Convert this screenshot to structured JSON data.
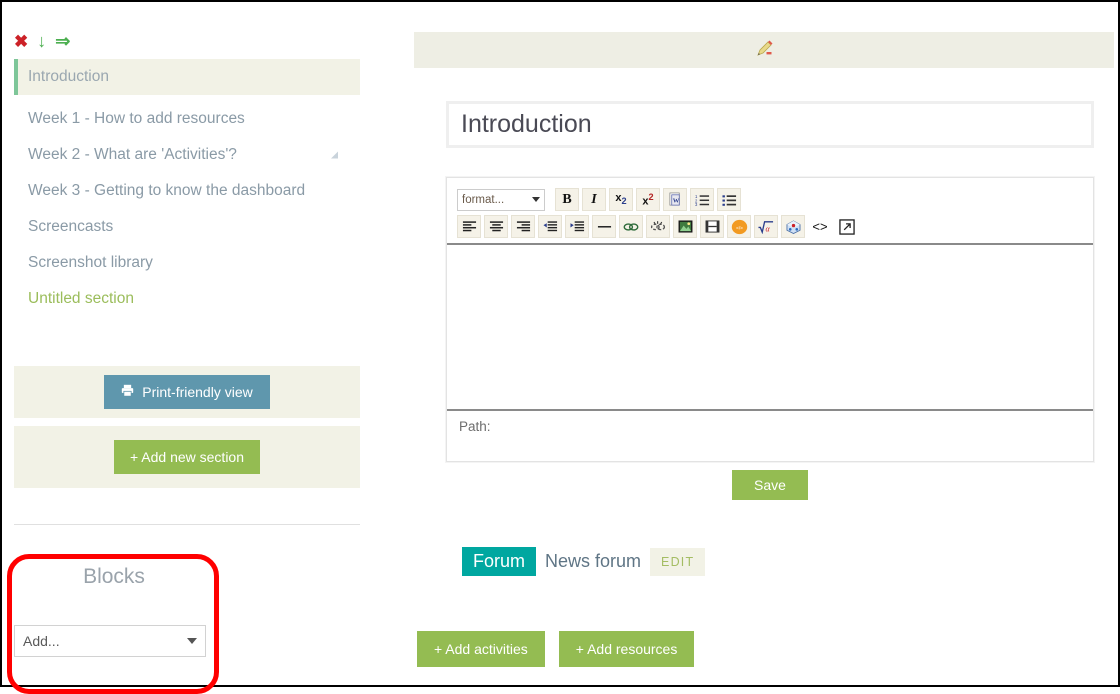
{
  "sidebar": {
    "section_tools": [
      {
        "name": "delete-section",
        "glyph": "✖",
        "label": "Delete section"
      },
      {
        "name": "move-down",
        "glyph": "↓",
        "label": "Move down"
      },
      {
        "name": "move-right",
        "glyph": "⇒",
        "label": "Move right"
      }
    ],
    "sections": [
      {
        "label": "Introduction",
        "active": true,
        "handle": false,
        "untitled": false
      },
      {
        "label": "Week 1 - How to add resources",
        "active": false,
        "handle": false,
        "untitled": false
      },
      {
        "label": "Week 2 - What are 'Activities'?",
        "active": false,
        "handle": true,
        "untitled": false
      },
      {
        "label": "Week 3 - Getting to know the dashboard",
        "active": false,
        "handle": false,
        "untitled": false
      },
      {
        "label": "Screencasts",
        "active": false,
        "handle": false,
        "untitled": false
      },
      {
        "label": "Screenshot library",
        "active": false,
        "handle": false,
        "untitled": false
      },
      {
        "label": "Untitled section",
        "active": false,
        "handle": false,
        "untitled": true
      }
    ],
    "print_button": "Print-friendly view",
    "add_section_button": "+ Add new section",
    "blocks": {
      "title": "Blocks",
      "add_select_value": "Add..."
    }
  },
  "main": {
    "edit_bar_icon": "pencil-icon",
    "title_value": "Introduction",
    "editor": {
      "format_select_value": "format...",
      "toolbar_row1": [
        {
          "name": "bold-icon",
          "label": "B"
        },
        {
          "name": "italic-icon",
          "label": "I"
        },
        {
          "name": "subscript-icon",
          "label": "x₂"
        },
        {
          "name": "superscript-icon",
          "label": "x²"
        },
        {
          "name": "paste-from-word-icon",
          "label": "W"
        },
        {
          "name": "ordered-list-icon",
          "label": "1."
        },
        {
          "name": "unordered-list-icon",
          "label": "•"
        }
      ],
      "toolbar_row2": [
        {
          "name": "align-left-icon",
          "label": "≡"
        },
        {
          "name": "align-center-icon",
          "label": "≡"
        },
        {
          "name": "align-right-icon",
          "label": "≡"
        },
        {
          "name": "outdent-icon",
          "label": "⇤"
        },
        {
          "name": "indent-icon",
          "label": "⇥"
        },
        {
          "name": "horizontal-rule-icon",
          "label": "—"
        },
        {
          "name": "insert-link-icon",
          "label": "⚭"
        },
        {
          "name": "unlink-icon",
          "label": "⚭"
        },
        {
          "name": "insert-image-icon",
          "label": "▣"
        },
        {
          "name": "insert-media-icon",
          "label": "▥"
        },
        {
          "name": "embed-code-icon",
          "label": "</>"
        },
        {
          "name": "equation-editor-icon",
          "label": "√α"
        },
        {
          "name": "chemistry-editor-icon",
          "label": "⬟"
        },
        {
          "name": "html-source-icon",
          "label": "<>"
        },
        {
          "name": "fullscreen-icon",
          "label": "⤡"
        }
      ],
      "content": "",
      "path_label": "Path:"
    },
    "save_button": "Save",
    "forum": {
      "badge": "Forum",
      "link": "News forum",
      "edit_button": "EDIT"
    },
    "add_activities_button": "+ Add activities",
    "add_resources_button": "+ Add resources"
  },
  "annotation": {
    "highlight_color": "#ff0000",
    "target": "blocks-panel"
  },
  "colors": {
    "accent_green": "#94bc52",
    "teal": "#00a7a0",
    "blue_gray": "#5f97ad",
    "cream": "#f2f2e6",
    "muted_text": "#8a9aa6"
  }
}
